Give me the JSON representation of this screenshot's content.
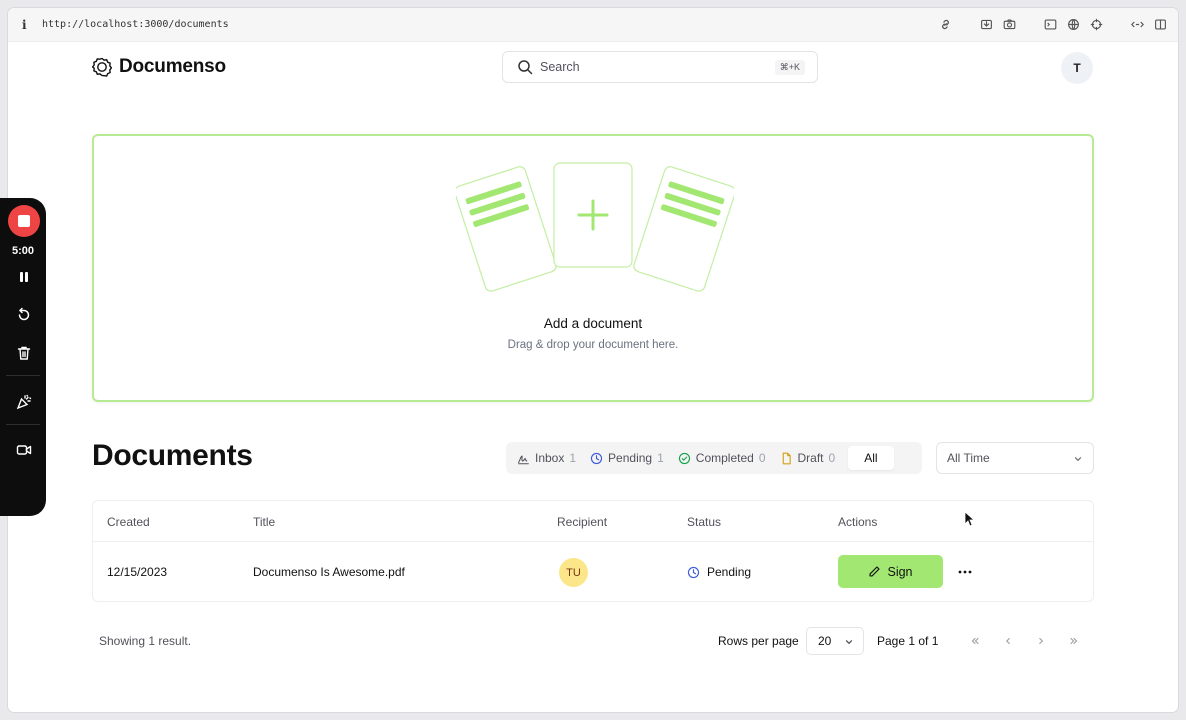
{
  "browser": {
    "info_glyph": "i",
    "url": "http://localhost:3000/documents",
    "tool_icons": [
      "link-icon",
      "save-icon",
      "camera-icon",
      "terminal-icon",
      "globe-icon",
      "crosshair-icon",
      "extensions-icon",
      "sidebar-icon"
    ]
  },
  "header": {
    "brand": "Documenso",
    "search_placeholder": "Search",
    "search_shortcut": "⌘+K",
    "user_initial": "T"
  },
  "dropzone": {
    "title": "Add a document",
    "subtitle": "Drag & drop your document here."
  },
  "documents": {
    "title": "Documents",
    "tabs": [
      {
        "label": "Inbox",
        "count": "1",
        "icon": "signature-icon"
      },
      {
        "label": "Pending",
        "count": "1",
        "icon": "clock-icon"
      },
      {
        "label": "Completed",
        "count": "0",
        "icon": "check-circle-icon"
      },
      {
        "label": "Draft",
        "count": "0",
        "icon": "file-icon"
      },
      {
        "label": "All",
        "active": true
      }
    ],
    "period_filter": "All Time",
    "table": {
      "columns": [
        "Created",
        "Title",
        "Recipient",
        "Status",
        "Actions"
      ],
      "rows": [
        {
          "created": "12/15/2023",
          "title": "Documenso Is Awesome.pdf",
          "recipient_initials": "TU",
          "status": "Pending",
          "action_label": "Sign"
        }
      ]
    },
    "pagination": {
      "showing": "Showing 1 result.",
      "rows_per_page_label": "Rows per page",
      "rows_per_page": "20",
      "page_info": "Page 1 of 1"
    }
  },
  "recorder": {
    "time": "5:00"
  },
  "colors": {
    "accent_green": "#a2e771",
    "dropzone_border": "#b7ea93",
    "record_red": "#ef4444",
    "avatar_yellow": "#fce68a"
  }
}
